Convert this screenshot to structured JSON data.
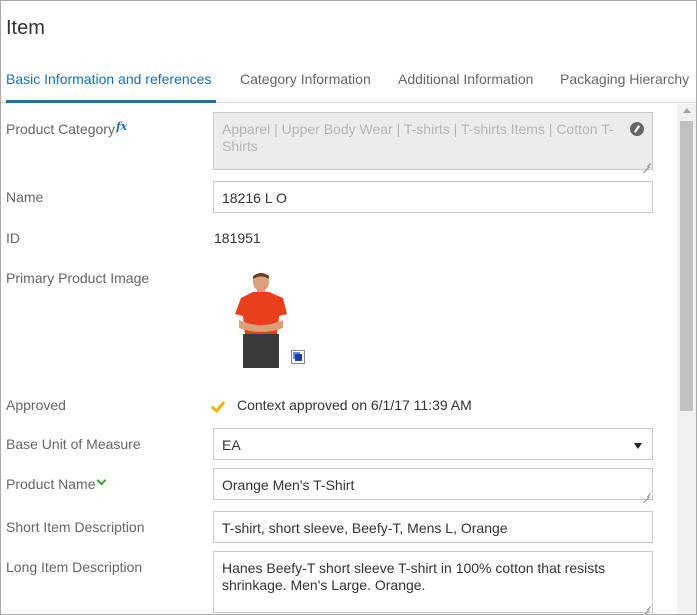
{
  "header": {
    "title": "Item"
  },
  "tabs": [
    {
      "label": "Basic Information and references",
      "active": true
    },
    {
      "label": "Category Information",
      "active": false
    },
    {
      "label": "Additional Information",
      "active": false
    },
    {
      "label": "Packaging Hierarchy",
      "active": false
    }
  ],
  "form": {
    "product_category": {
      "label": "Product Category",
      "value": "Apparel | Upper Body Wear | T-shirts | T-shirts Items | Cotton T-Shirts"
    },
    "name": {
      "label": "Name",
      "value": "18216 L O"
    },
    "id": {
      "label": "ID",
      "value": "181951"
    },
    "primary_image": {
      "label": "Primary Product Image"
    },
    "approved": {
      "label": "Approved",
      "value": "Context approved on 6/1/17 11:39 AM"
    },
    "base_unit": {
      "label": "Base Unit of Measure",
      "value": "EA"
    },
    "product_name": {
      "label": "Product Name",
      "value": "Orange Men's T-Shirt"
    },
    "short_desc": {
      "label": "Short Item Description",
      "value": "T-shirt, short sleeve, Beefy-T, Mens L, Orange"
    },
    "long_desc": {
      "label": "Long Item Description",
      "value": "Hanes Beefy-T short sleeve T-shirt in 100% cotton that resists shrinkage. Men's Large. Orange."
    }
  },
  "colors": {
    "accent": "#1a6fa8",
    "check": "#f0b400",
    "shirt": "#e8401a"
  }
}
